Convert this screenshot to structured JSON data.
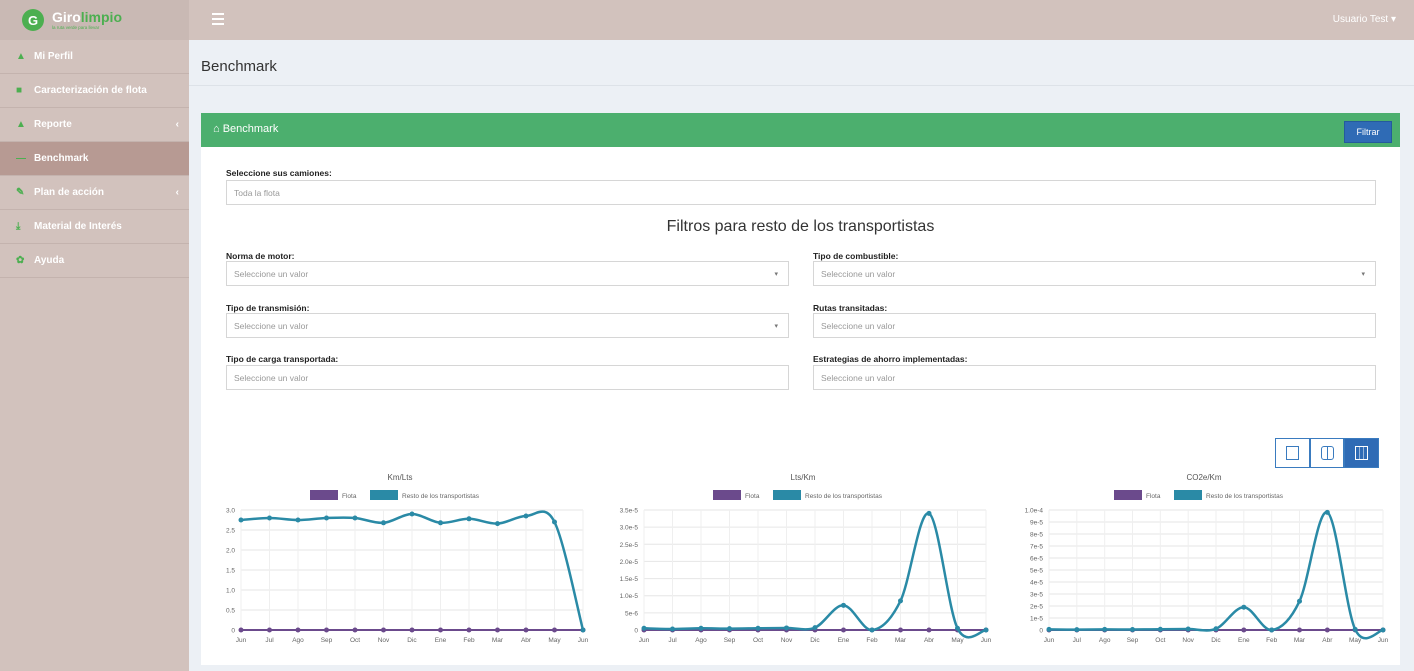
{
  "app": {
    "logo_letter": "G",
    "logo_word1": "Giro",
    "logo_word2": "limpio",
    "logo_tagline": "la ruta verde para llevar",
    "user_label": "Usuario Test ▾"
  },
  "sidebar": {
    "items": [
      {
        "label": "Mi Perfil",
        "icon": "user-icon",
        "chevron": ""
      },
      {
        "label": "Caracterización de flota",
        "icon": "truck-icon",
        "chevron": ""
      },
      {
        "label": "Reporte",
        "icon": "report-icon",
        "chevron": "‹"
      },
      {
        "label": "Benchmark",
        "icon": "chart-icon",
        "chevron": ""
      },
      {
        "label": "Plan de acción",
        "icon": "plan-icon",
        "chevron": "‹"
      },
      {
        "label": "Material de Interés",
        "icon": "download-icon",
        "chevron": ""
      },
      {
        "label": "Ayuda",
        "icon": "help-icon",
        "chevron": ""
      }
    ],
    "active_index": 3
  },
  "header": {
    "page_title": "Benchmark"
  },
  "panel": {
    "title": "Benchmark",
    "filter_button": "Filtrar",
    "camiones_label": "Seleccione sus camiones:",
    "camiones_value": "Toda la flota",
    "filters_heading": "Filtros para resto de los transportistas",
    "fields": {
      "norma_label": "Norma de motor:",
      "norma_placeholder": "Seleccione un valor",
      "combustible_label": "Tipo de combustible:",
      "combustible_placeholder": "Seleccione un valor",
      "transmision_label": "Tipo de transmisión:",
      "transmision_placeholder": "Seleccione un valor",
      "rutas_label": "Rutas transitadas:",
      "rutas_placeholder": "Seleccione un valor",
      "carga_label": "Tipo de carga transportada:",
      "carga_placeholder": "Seleccione un valor",
      "estrategias_label": "Estrategias de ahorro implementadas:",
      "estrategias_placeholder": "Seleccione un valor"
    }
  },
  "colors": {
    "flota": "#6b4a8c",
    "resto": "#2a8aa6",
    "green_header": "#4caf6e",
    "blue_button": "#2f6bb5"
  },
  "chart_data": [
    {
      "type": "line",
      "title": "Km/Lts",
      "x": [
        "Jun",
        "Jul",
        "Ago",
        "Sep",
        "Oct",
        "Nov",
        "Dic",
        "Ene",
        "Feb",
        "Mar",
        "Abr",
        "May",
        "Jun"
      ],
      "series": [
        {
          "name": "Flota",
          "values": [
            0,
            0,
            0,
            0,
            0,
            0,
            0,
            0,
            0,
            0,
            0,
            0,
            0
          ]
        },
        {
          "name": "Resto de los transportistas",
          "values": [
            2.75,
            2.8,
            2.75,
            2.8,
            2.8,
            2.68,
            2.9,
            2.68,
            2.78,
            2.66,
            2.85,
            2.7,
            0
          ]
        }
      ],
      "yticks": [
        "0",
        "0.5",
        "1.0",
        "1.5",
        "2.0",
        "2.5",
        "3.0"
      ],
      "ylim": [
        0,
        3.0
      ]
    },
    {
      "type": "line",
      "title": "Lts/Km",
      "x": [
        "Jun",
        "Jul",
        "Ago",
        "Sep",
        "Oct",
        "Nov",
        "Dic",
        "Ene",
        "Feb",
        "Mar",
        "Abr",
        "May",
        "Jun"
      ],
      "series": [
        {
          "name": "Flota",
          "values": [
            0,
            0,
            0,
            0,
            0,
            0,
            0,
            0,
            0,
            0,
            0,
            0,
            0
          ]
        },
        {
          "name": "Resto de los transportistas",
          "values": [
            5e-07,
            3e-07,
            5e-07,
            4e-07,
            5e-07,
            6e-07,
            7e-07,
            7.2e-06,
            0,
            8.5e-06,
            3.4e-05,
            5e-07,
            0
          ]
        }
      ],
      "yticks": [
        "0",
        "5e-6",
        "1.0e-5",
        "1.5e-5",
        "2.0e-5",
        "2.5e-5",
        "3.0e-5",
        "3.5e-5"
      ],
      "ylim": [
        0,
        3.5e-05
      ]
    },
    {
      "type": "line",
      "title": "CO2e/Km",
      "x": [
        "Jun",
        "Jul",
        "Ago",
        "Sep",
        "Oct",
        "Nov",
        "Dic",
        "Ene",
        "Feb",
        "Mar",
        "Abr",
        "May",
        "Jun"
      ],
      "series": [
        {
          "name": "Flota",
          "values": [
            0,
            0,
            0,
            0,
            0,
            0,
            0,
            0,
            0,
            0,
            0,
            0,
            0
          ]
        },
        {
          "name": "Resto de los transportistas",
          "values": [
            5e-07,
            3e-07,
            5e-07,
            4e-07,
            6e-07,
            8e-07,
            1e-06,
            1.9e-05,
            0,
            2.4e-05,
            9.8e-05,
            5e-07,
            0
          ]
        }
      ],
      "yticks": [
        "0",
        "1e-5",
        "2e-5",
        "3e-5",
        "4e-5",
        "5e-5",
        "6e-5",
        "7e-5",
        "8e-5",
        "9e-5",
        "1.0e-4"
      ],
      "ylim": [
        0,
        0.0001
      ]
    }
  ]
}
